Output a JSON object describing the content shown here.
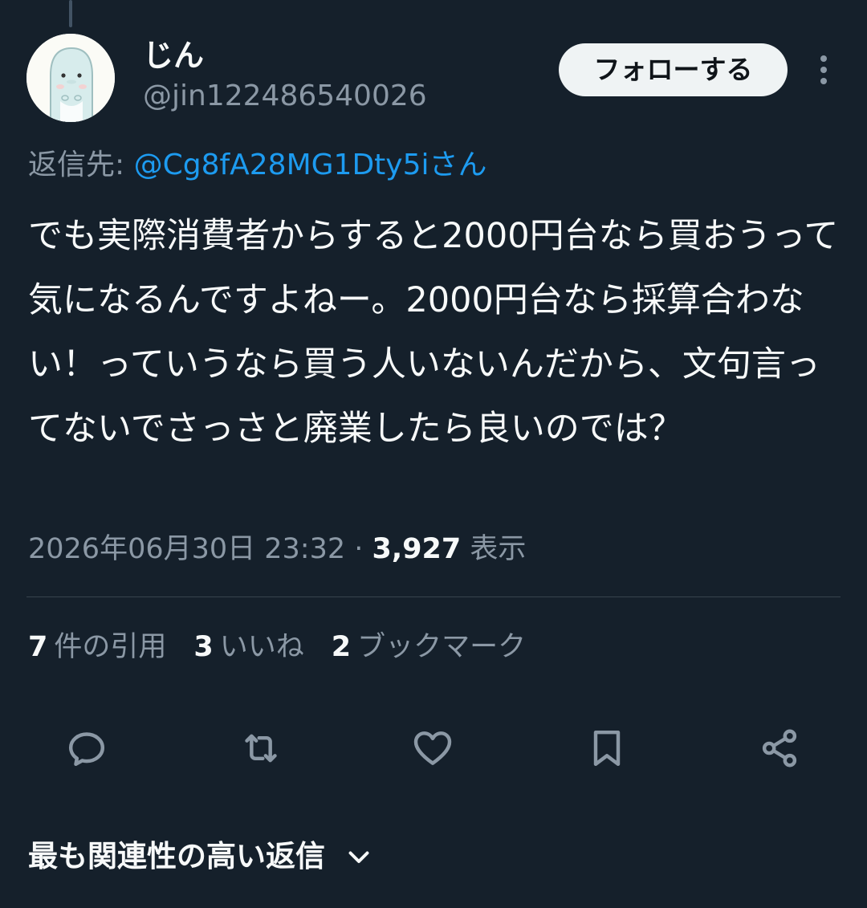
{
  "author": {
    "display_name": "じん",
    "handle": "@jin122486540026",
    "avatar_icon": "character-avatar-icon"
  },
  "header": {
    "follow_label": "フォローする",
    "more_icon": "more-vertical-icon"
  },
  "reply": {
    "prefix": "返信先: ",
    "mention": "@Cg8fA28MG1Dty5iさん"
  },
  "tweet": {
    "text": "でも実際消費者からすると2000円台なら買おうって気になるんですよねー。2000円台なら採算合わない！っていうなら買う人いないんだから、文句言ってないでさっさと廃業したら良いのでは？"
  },
  "meta": {
    "timestamp": "2026年06月30日 23:32",
    "separator": " · ",
    "views_count": "3,927",
    "views_label": " 表示"
  },
  "stats": {
    "quotes_count": "7",
    "quotes_label": "件の引用",
    "likes_count": "3",
    "likes_label": "いいね",
    "bookmarks_count": "2",
    "bookmarks_label": "ブックマーク"
  },
  "actions": {
    "reply_icon": "reply-icon",
    "retweet_icon": "retweet-icon",
    "like_icon": "heart-icon",
    "bookmark_icon": "bookmark-icon",
    "share_icon": "share-icon"
  },
  "footer": {
    "sort_label": "最も関連性の高い返信",
    "chevron_icon": "chevron-down-icon"
  },
  "colors": {
    "background": "#15202b",
    "text_primary": "#f7f9f9",
    "text_secondary": "#8b98a5",
    "link": "#1d9bf0",
    "divider": "#38444d"
  }
}
